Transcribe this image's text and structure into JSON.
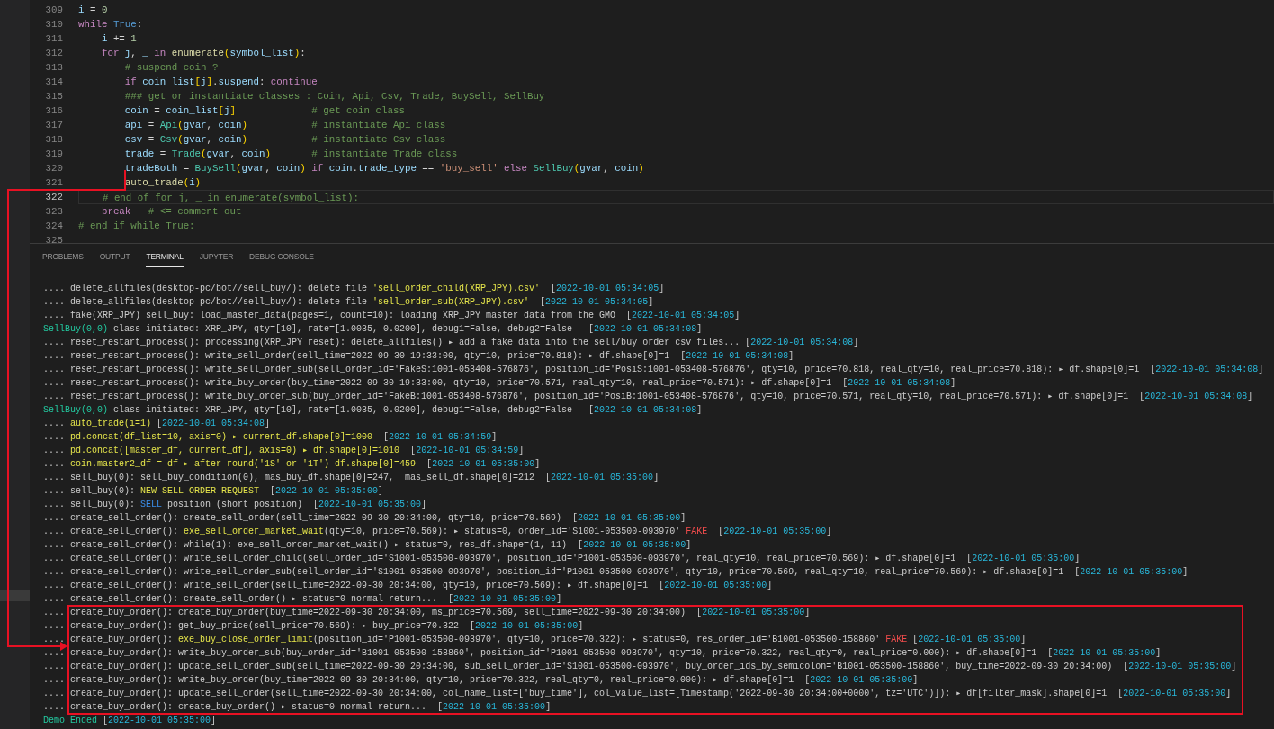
{
  "editor": {
    "lines": [
      {
        "number": "309",
        "current": false,
        "segments": [
          {
            "kind": "var",
            "text": "i"
          },
          {
            "kind": "op",
            "text": " = "
          },
          {
            "kind": "num",
            "text": "0"
          }
        ]
      },
      {
        "number": "310",
        "current": false,
        "segments": [
          {
            "kind": "kw",
            "text": "while"
          },
          {
            "kind": "const",
            "text": " True"
          },
          {
            "kind": "op",
            "text": ":"
          }
        ]
      },
      {
        "number": "311",
        "current": false,
        "segments": [
          {
            "kind": "var",
            "text": "    i"
          },
          {
            "kind": "op",
            "text": " += "
          },
          {
            "kind": "num",
            "text": "1"
          }
        ]
      },
      {
        "number": "312",
        "current": false,
        "segments": [
          {
            "kind": "kw",
            "text": "    for"
          },
          {
            "kind": "var",
            "text": " j"
          },
          {
            "kind": "op",
            "text": ", "
          },
          {
            "kind": "var",
            "text": "_"
          },
          {
            "kind": "kw",
            "text": " in"
          },
          {
            "kind": "fn",
            "text": " enumerate"
          },
          {
            "kind": "br1",
            "text": "("
          },
          {
            "kind": "var",
            "text": "symbol_list"
          },
          {
            "kind": "br1",
            "text": ")"
          },
          {
            "kind": "op",
            "text": ":"
          }
        ]
      },
      {
        "number": "313",
        "current": false,
        "segments": [
          {
            "kind": "cmt",
            "text": "        # suspend coin ?"
          }
        ]
      },
      {
        "number": "314",
        "current": false,
        "segments": [
          {
            "kind": "kw",
            "text": "        if"
          },
          {
            "kind": "var",
            "text": " coin_list"
          },
          {
            "kind": "br1",
            "text": "["
          },
          {
            "kind": "var",
            "text": "j"
          },
          {
            "kind": "br1",
            "text": "]"
          },
          {
            "kind": "op",
            "text": "."
          },
          {
            "kind": "var",
            "text": "suspend"
          },
          {
            "kind": "op",
            "text": ": "
          },
          {
            "kind": "kw",
            "text": "continue"
          }
        ]
      },
      {
        "number": "315",
        "current": false,
        "segments": [
          {
            "kind": "cmt",
            "text": "        ### get or instantiate classes : Coin, Api, Csv, Trade, BuySell, SellBuy"
          }
        ]
      },
      {
        "number": "316",
        "current": false,
        "segments": [
          {
            "kind": "var",
            "text": "        coin"
          },
          {
            "kind": "op",
            "text": " = "
          },
          {
            "kind": "var",
            "text": "coin_list"
          },
          {
            "kind": "br1",
            "text": "["
          },
          {
            "kind": "var",
            "text": "j"
          },
          {
            "kind": "br1",
            "text": "]"
          },
          {
            "kind": "cmt",
            "text": "             # get coin class"
          }
        ]
      },
      {
        "number": "317",
        "current": false,
        "segments": [
          {
            "kind": "var",
            "text": "        api"
          },
          {
            "kind": "op",
            "text": " = "
          },
          {
            "kind": "cls",
            "text": "Api"
          },
          {
            "kind": "br1",
            "text": "("
          },
          {
            "kind": "var",
            "text": "gvar"
          },
          {
            "kind": "op",
            "text": ", "
          },
          {
            "kind": "var",
            "text": "coin"
          },
          {
            "kind": "br1",
            "text": ")"
          },
          {
            "kind": "cmt",
            "text": "           # instantiate Api class"
          }
        ]
      },
      {
        "number": "318",
        "current": false,
        "segments": [
          {
            "kind": "var",
            "text": "        csv"
          },
          {
            "kind": "op",
            "text": " = "
          },
          {
            "kind": "cls",
            "text": "Csv"
          },
          {
            "kind": "br1",
            "text": "("
          },
          {
            "kind": "var",
            "text": "gvar"
          },
          {
            "kind": "op",
            "text": ", "
          },
          {
            "kind": "var",
            "text": "coin"
          },
          {
            "kind": "br1",
            "text": ")"
          },
          {
            "kind": "cmt",
            "text": "           # instantiate Csv class"
          }
        ]
      },
      {
        "number": "319",
        "current": false,
        "segments": [
          {
            "kind": "var",
            "text": "        trade"
          },
          {
            "kind": "op",
            "text": " = "
          },
          {
            "kind": "cls",
            "text": "Trade"
          },
          {
            "kind": "br1",
            "text": "("
          },
          {
            "kind": "var",
            "text": "gvar"
          },
          {
            "kind": "op",
            "text": ", "
          },
          {
            "kind": "var",
            "text": "coin"
          },
          {
            "kind": "br1",
            "text": ")"
          },
          {
            "kind": "cmt",
            "text": "       # instantiate Trade class"
          }
        ]
      },
      {
        "number": "320",
        "current": false,
        "segments": [
          {
            "kind": "var",
            "text": "        tradeBoth"
          },
          {
            "kind": "op",
            "text": " = "
          },
          {
            "kind": "cls",
            "text": "BuySell"
          },
          {
            "kind": "br1",
            "text": "("
          },
          {
            "kind": "var",
            "text": "gvar"
          },
          {
            "kind": "op",
            "text": ", "
          },
          {
            "kind": "var",
            "text": "coin"
          },
          {
            "kind": "br1",
            "text": ")"
          },
          {
            "kind": "kw",
            "text": " if"
          },
          {
            "kind": "var",
            "text": " coin"
          },
          {
            "kind": "op",
            "text": "."
          },
          {
            "kind": "var",
            "text": "trade_type"
          },
          {
            "kind": "op",
            "text": " == "
          },
          {
            "kind": "str",
            "text": "'buy_sell'"
          },
          {
            "kind": "kw",
            "text": " else"
          },
          {
            "kind": "cls",
            "text": " SellBuy"
          },
          {
            "kind": "br1",
            "text": "("
          },
          {
            "kind": "var",
            "text": "gvar"
          },
          {
            "kind": "op",
            "text": ", "
          },
          {
            "kind": "var",
            "text": "coin"
          },
          {
            "kind": "br1",
            "text": ")"
          }
        ]
      },
      {
        "number": "321",
        "current": false,
        "segments": [
          {
            "kind": "fn",
            "text": "        auto_trade"
          },
          {
            "kind": "br1",
            "text": "("
          },
          {
            "kind": "var",
            "text": "i"
          },
          {
            "kind": "br1",
            "text": ")"
          }
        ]
      },
      {
        "number": "322",
        "current": true,
        "segments": [
          {
            "kind": "cmt",
            "text": "    # end of for j, _ in enumerate(symbol_list):"
          }
        ]
      },
      {
        "number": "323",
        "current": false,
        "segments": [
          {
            "kind": "kw",
            "text": "    break"
          },
          {
            "kind": "cmt",
            "text": "   # <= comment out"
          }
        ]
      },
      {
        "number": "324",
        "current": false,
        "segments": [
          {
            "kind": "cmt",
            "text": "# end if while True:"
          }
        ]
      },
      {
        "number": "325",
        "current": false
      }
    ]
  },
  "panel": {
    "tabs": [
      {
        "label": "PROBLEMS",
        "selected": false
      },
      {
        "label": "OUTPUT",
        "selected": false
      },
      {
        "label": "TERMINAL",
        "selected": true
      },
      {
        "label": "JUPYTER",
        "selected": false
      },
      {
        "label": "DEBUG CONSOLE",
        "selected": false
      }
    ]
  },
  "terminal": {
    "lines": [
      {
        "segments": [
          {
            "kind": "plain",
            "text": ".... delete_allfiles(desktop-pc/bot//sell_buy/): delete file "
          },
          {
            "kind": "yellow",
            "text": "'sell_order_child(XRP_JPY).csv'"
          },
          {
            "kind": "plain",
            "text": "  ["
          },
          {
            "kind": "time",
            "text": "2022-10-01 05:34:05"
          },
          {
            "kind": "plain",
            "text": "]"
          }
        ]
      },
      {
        "segments": [
          {
            "kind": "plain",
            "text": ".... delete_allfiles(desktop-pc/bot//sell_buy/): delete file "
          },
          {
            "kind": "yellow",
            "text": "'sell_order_sub(XRP_JPY).csv'"
          },
          {
            "kind": "plain",
            "text": "  ["
          },
          {
            "kind": "time",
            "text": "2022-10-01 05:34:05"
          },
          {
            "kind": "plain",
            "text": "]"
          }
        ]
      },
      {
        "segments": [
          {
            "kind": "plain",
            "text": ".... fake(XRP_JPY) sell_buy: load_master_data(pages=1, count=10): loading XRP_JPY master data from the GMO  ["
          },
          {
            "kind": "time",
            "text": "2022-10-01 05:34:05"
          },
          {
            "kind": "plain",
            "text": "]"
          }
        ]
      },
      {
        "segments": [
          {
            "kind": "green",
            "text": "SellBuy(0,0)"
          },
          {
            "kind": "plain",
            "text": " class initiated: XRP_JPY, qty=[10], rate=[1.0035, 0.0200], debug1=False, debug2=False   ["
          },
          {
            "kind": "time",
            "text": "2022-10-01 05:34:08"
          },
          {
            "kind": "plain",
            "text": "]"
          }
        ]
      },
      {
        "segments": [
          {
            "kind": "plain",
            "text": ".... reset_restart_process(): processing(XRP_JPY reset): delete_allfiles() ▸ add a fake data into the sell/buy order csv files... ["
          },
          {
            "kind": "time",
            "text": "2022-10-01 05:34:08"
          },
          {
            "kind": "plain",
            "text": "]"
          }
        ]
      },
      {
        "segments": [
          {
            "kind": "plain",
            "text": ".... reset_restart_process(): write_sell_order(sell_time=2022-09-30 19:33:00, qty=10, price=70.818): ▸ df.shape[0]=1  ["
          },
          {
            "kind": "time",
            "text": "2022-10-01 05:34:08"
          },
          {
            "kind": "plain",
            "text": "]"
          }
        ]
      },
      {
        "segments": [
          {
            "kind": "plain",
            "text": ".... reset_restart_process(): write_sell_order_sub(sell_order_id='FakeS:1001-053408-576876', position_id='PosiS:1001-053408-576876', qty=10, price=70.818, real_qty=10, real_price=70.818): ▸ df.shape[0]=1  ["
          },
          {
            "kind": "time",
            "text": "2022-10-01 05:34:08"
          },
          {
            "kind": "plain",
            "text": "]"
          }
        ]
      },
      {
        "segments": [
          {
            "kind": "plain",
            "text": ".... reset_restart_process(): write_buy_order(buy_time=2022-09-30 19:33:00, qty=10, price=70.571, real_qty=10, real_price=70.571): ▸ df.shape[0]=1  ["
          },
          {
            "kind": "time",
            "text": "2022-10-01 05:34:08"
          },
          {
            "kind": "plain",
            "text": "]"
          }
        ]
      },
      {
        "segments": [
          {
            "kind": "plain",
            "text": ".... reset_restart_process(): write_buy_order_sub(buy_order_id='FakeB:1001-053408-576876', position_id='PosiB:1001-053408-576876', qty=10, price=70.571, real_qty=10, real_price=70.571): ▸ df.shape[0]=1  ["
          },
          {
            "kind": "time",
            "text": "2022-10-01 05:34:08"
          },
          {
            "kind": "plain",
            "text": "]"
          }
        ]
      },
      {
        "segments": [
          {
            "kind": "green",
            "text": "SellBuy(0,0)"
          },
          {
            "kind": "plain",
            "text": " class initiated: XRP_JPY, qty=[10], rate=[1.0035, 0.0200], debug1=False, debug2=False   ["
          },
          {
            "kind": "time",
            "text": "2022-10-01 05:34:08"
          },
          {
            "kind": "plain",
            "text": "]"
          }
        ]
      },
      {
        "segments": [
          {
            "kind": "plain",
            "text": ".... "
          },
          {
            "kind": "yellow",
            "text": "auto_trade(i=1)"
          },
          {
            "kind": "plain",
            "text": " ["
          },
          {
            "kind": "time",
            "text": "2022-10-01 05:34:08"
          },
          {
            "kind": "plain",
            "text": "]"
          }
        ]
      },
      {
        "segments": [
          {
            "kind": "plain",
            "text": ".... "
          },
          {
            "kind": "yellow",
            "text": "pd.concat(df_list=10, axis=0) ▸ current_df.shape[0]=1000"
          },
          {
            "kind": "plain",
            "text": "  ["
          },
          {
            "kind": "time",
            "text": "2022-10-01 05:34:59"
          },
          {
            "kind": "plain",
            "text": "]"
          }
        ]
      },
      {
        "segments": [
          {
            "kind": "plain",
            "text": ".... "
          },
          {
            "kind": "yellow",
            "text": "pd.concat([master_df, current_df], axis=0) ▸ df.shape[0]=1010"
          },
          {
            "kind": "plain",
            "text": "  ["
          },
          {
            "kind": "time",
            "text": "2022-10-01 05:34:59"
          },
          {
            "kind": "plain",
            "text": "]"
          }
        ]
      },
      {
        "segments": [
          {
            "kind": "plain",
            "text": ".... "
          },
          {
            "kind": "yellow",
            "text": "coin.master2_df = df ▸ after round('1S' or '1T') df.shape[0]=459"
          },
          {
            "kind": "plain",
            "text": "  ["
          },
          {
            "kind": "time",
            "text": "2022-10-01 05:35:00"
          },
          {
            "kind": "plain",
            "text": "]"
          }
        ]
      },
      {
        "segments": [
          {
            "kind": "plain",
            "text": ".... sell_buy(0): sell_buy_condition(0), mas_buy_df.shape[0]=247,  mas_sell_df.shape[0]=212  ["
          },
          {
            "kind": "time",
            "text": "2022-10-01 05:35:00"
          },
          {
            "kind": "plain",
            "text": "]"
          }
        ]
      },
      {
        "segments": [
          {
            "kind": "plain",
            "text": ".... sell_buy(0): "
          },
          {
            "kind": "yellow",
            "text": "NEW SELL ORDER REQUEST"
          },
          {
            "kind": "plain",
            "text": "  ["
          },
          {
            "kind": "time",
            "text": "2022-10-01 05:35:00"
          },
          {
            "kind": "plain",
            "text": "]"
          }
        ]
      },
      {
        "segments": [
          {
            "kind": "plain",
            "text": ".... sell_buy(0): "
          },
          {
            "kind": "blue",
            "text": "SELL"
          },
          {
            "kind": "plain",
            "text": " position (short position)  ["
          },
          {
            "kind": "time",
            "text": "2022-10-01 05:35:00"
          },
          {
            "kind": "plain",
            "text": "]"
          }
        ]
      },
      {
        "segments": [
          {
            "kind": "plain",
            "text": ".... create_sell_order(): create_sell_order(sell_time=2022-09-30 20:34:00, qty=10, price=70.569)  ["
          },
          {
            "kind": "time",
            "text": "2022-10-01 05:35:00"
          },
          {
            "kind": "plain",
            "text": "]"
          }
        ]
      },
      {
        "segments": [
          {
            "kind": "plain",
            "text": ".... create_sell_order(): "
          },
          {
            "kind": "yellow",
            "text": "exe_sell_order_market_wait"
          },
          {
            "kind": "plain",
            "text": "(qty=10, price=70.569): ▸ status=0, order_id='S1001-053500-093970' "
          },
          {
            "kind": "red",
            "text": "FAKE"
          },
          {
            "kind": "plain",
            "text": "  ["
          },
          {
            "kind": "time",
            "text": "2022-10-01 05:35:00"
          },
          {
            "kind": "plain",
            "text": "]"
          }
        ]
      },
      {
        "segments": [
          {
            "kind": "plain",
            "text": ".... create_sell_order(): while(1): exe_sell_order_market_wait() ▸ status=0, res_df.shape=(1, 11)  ["
          },
          {
            "kind": "time",
            "text": "2022-10-01 05:35:00"
          },
          {
            "kind": "plain",
            "text": "]"
          }
        ]
      },
      {
        "segments": [
          {
            "kind": "plain",
            "text": ".... create_sell_order(): write_sell_order_child(sell_order_id='S1001-053500-093970', position_id='P1001-053500-093970', real_qty=10, real_price=70.569): ▸ df.shape[0]=1  ["
          },
          {
            "kind": "time",
            "text": "2022-10-01 05:35:00"
          },
          {
            "kind": "plain",
            "text": "]"
          }
        ]
      },
      {
        "segments": [
          {
            "kind": "plain",
            "text": ".... create_sell_order(): write_sell_order_sub(sell_order_id='S1001-053500-093970', position_id='P1001-053500-093970', qty=10, price=70.569, real_qty=10, real_price=70.569): ▸ df.shape[0]=1  ["
          },
          {
            "kind": "time",
            "text": "2022-10-01 05:35:00"
          },
          {
            "kind": "plain",
            "text": "]"
          }
        ]
      },
      {
        "segments": [
          {
            "kind": "plain",
            "text": ".... create_sell_order(): write_sell_order(sell_time=2022-09-30 20:34:00, qty=10, price=70.569): ▸ df.shape[0]=1  ["
          },
          {
            "kind": "time",
            "text": "2022-10-01 05:35:00"
          },
          {
            "kind": "plain",
            "text": "]"
          }
        ]
      },
      {
        "segments": [
          {
            "kind": "plain",
            "text": ".... create_sell_order(): create_sell_order() ▸ status=0 normal return...  ["
          },
          {
            "kind": "time",
            "text": "2022-10-01 05:35:00"
          },
          {
            "kind": "plain",
            "text": "]"
          }
        ]
      },
      {
        "segments": [
          {
            "kind": "plain",
            "text": ".... create_buy_order(): create_buy_order(buy_time=2022-09-30 20:34:00, ms_price=70.569, sell_time=2022-09-30 20:34:00)  ["
          },
          {
            "kind": "time",
            "text": "2022-10-01 05:35:00"
          },
          {
            "kind": "plain",
            "text": "]"
          }
        ]
      },
      {
        "segments": [
          {
            "kind": "plain",
            "text": ".... create_buy_order(): get_buy_price(sell_price=70.569): ▸ buy_price=70.322  ["
          },
          {
            "kind": "time",
            "text": "2022-10-01 05:35:00"
          },
          {
            "kind": "plain",
            "text": "]"
          }
        ]
      },
      {
        "segments": [
          {
            "kind": "plain",
            "text": ".... create_buy_order(): "
          },
          {
            "kind": "yellow",
            "text": "exe_buy_close_order_limit"
          },
          {
            "kind": "plain",
            "text": "(position_id='P1001-053500-093970', qty=10, price=70.322): ▸ status=0, res_order_id='B1001-053500-158860' "
          },
          {
            "kind": "red",
            "text": "FAKE"
          },
          {
            "kind": "plain",
            "text": " ["
          },
          {
            "kind": "time",
            "text": "2022-10-01 05:35:00"
          },
          {
            "kind": "plain",
            "text": "]"
          }
        ]
      },
      {
        "segments": [
          {
            "kind": "plain",
            "text": ".... create_buy_order(): write_buy_order_sub(buy_order_id='B1001-053500-158860', position_id='P1001-053500-093970', qty=10, price=70.322, real_qty=0, real_price=0.000): ▸ df.shape[0]=1  ["
          },
          {
            "kind": "time",
            "text": "2022-10-01 05:35:00"
          },
          {
            "kind": "plain",
            "text": "]"
          }
        ]
      },
      {
        "segments": [
          {
            "kind": "plain",
            "text": ".... create_buy_order(): update_sell_order_sub(sell_time=2022-09-30 20:34:00, sub_sell_order_id='S1001-053500-093970', buy_order_ids_by_semicolon='B1001-053500-158860', buy_time=2022-09-30 20:34:00)  ["
          },
          {
            "kind": "time",
            "text": "2022-10-01 05:35:00"
          },
          {
            "kind": "plain",
            "text": "]"
          }
        ]
      },
      {
        "segments": [
          {
            "kind": "plain",
            "text": ".... create_buy_order(): write_buy_order(buy_time=2022-09-30 20:34:00, qty=10, price=70.322, real_qty=0, real_price=0.000): ▸ df.shape[0]=1  ["
          },
          {
            "kind": "time",
            "text": "2022-10-01 05:35:00"
          },
          {
            "kind": "plain",
            "text": "]"
          }
        ]
      },
      {
        "segments": [
          {
            "kind": "plain",
            "text": ".... create_buy_order(): update_sell_order(sell_time=2022-09-30 20:34:00, col_name_list=['buy_time'], col_value_list=[Timestamp('2022-09-30 20:34:00+0000', tz='UTC')]): ▸ df[filter_mask].shape[0]=1  ["
          },
          {
            "kind": "time",
            "text": "2022-10-01 05:35:00"
          },
          {
            "kind": "plain",
            "text": "]"
          }
        ]
      },
      {
        "segments": [
          {
            "kind": "plain",
            "text": ".... create_buy_order(): create_buy_order() ▸ status=0 normal return...  ["
          },
          {
            "kind": "time",
            "text": "2022-10-01 05:35:00"
          },
          {
            "kind": "plain",
            "text": "]"
          }
        ]
      },
      {
        "segments": [
          {
            "kind": "green",
            "text": "Demo Ended"
          },
          {
            "kind": "plain",
            "text": " ["
          },
          {
            "kind": "time",
            "text": "2022-10-01 05:35:00"
          },
          {
            "kind": "plain",
            "text": "]"
          }
        ]
      }
    ]
  }
}
